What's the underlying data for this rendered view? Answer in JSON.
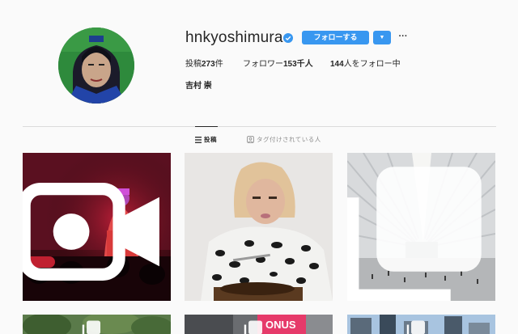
{
  "profile": {
    "username": "hnkyoshimura",
    "follow_label": "フォローする",
    "dropdown_glyph": "▼",
    "more_glyph": "···",
    "posts_label": "投稿",
    "posts_count": "273",
    "posts_suffix": "件",
    "followers_label": "フォロワー",
    "followers_count": "153千人",
    "following_count": "144",
    "following_label": "人をフォロー中",
    "full_name": "吉村 崇"
  },
  "tabs": [
    {
      "label": "投稿",
      "icon": "grid-icon",
      "active": true
    },
    {
      "label": "タグ付けされている人",
      "icon": "tag-icon",
      "active": false
    }
  ],
  "posts": [
    {
      "subject": "video-stage-performer",
      "badge": "video-icon"
    },
    {
      "subject": "portrait-leopard-print",
      "badge": ""
    },
    {
      "subject": "oculus-hall-architecture",
      "badge": "multi-image-icon"
    },
    {
      "subject": "trees-partial",
      "badge": "multi-image-icon"
    },
    {
      "subject": "street-sign-onus",
      "badge": "multi-image-icon",
      "sign_text": "ONUS"
    },
    {
      "subject": "city-skyline-partial",
      "badge": "multi-image-icon"
    }
  ],
  "colors": {
    "accent": "#3897f0",
    "background": "#fafafa",
    "text": "#262626",
    "muted": "#8e8e8e"
  }
}
